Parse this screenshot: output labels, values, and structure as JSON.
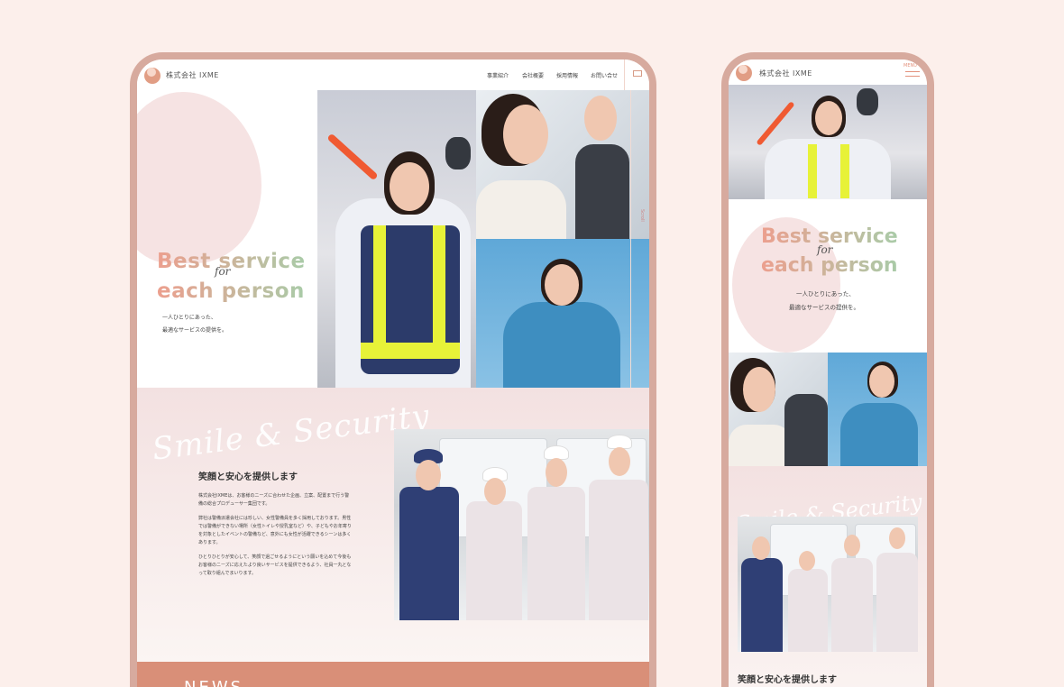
{
  "desktop": {
    "company": "株式会社 IXME",
    "nav": [
      "事業紹介",
      "会社概要",
      "採用情報",
      "お問い合せ"
    ],
    "hero": {
      "line1": "Best service",
      "for": "for",
      "line2": "each person",
      "sub1": "一人ひとりにあった、",
      "sub2": "最適なサービスの提供を。"
    },
    "vertical_text": "Scroll",
    "about": {
      "script": "Smile & Security",
      "title": "笑顔と安心を提供します",
      "p1": "株式会社IXMEは、お客様のニーズに合わせた企画、立案、配置まで行う警備の総合プロデューサー集団です。",
      "p2": "弊社は警備派遣会社には珍しい、女性警備員を多く採用しております。男性では警備ができない場所（女性トイレや授乳室など）や、子どもやお年寄りを対象としたイベントの警備など、意外にも女性が活躍できるシーンは多くあります。",
      "p3": "ひとりひとりが安心して、笑顔で過ごせるようにという願いを込めて今後もお客様のニーズに応えたより良いサービスを提供できるよう、社員一丸となって取り組んでまいります。"
    },
    "news_title": "NEWS"
  },
  "mobile": {
    "company": "株式会社 IXME",
    "menu_label": "MENU",
    "hero": {
      "line1": "Best service",
      "for": "for",
      "line2": "each person",
      "sub1": "一人ひとりにあった、",
      "sub2": "最適なサービスの提供を。"
    },
    "about": {
      "script": "Smile & Security",
      "title": "笑顔と安心を提供します"
    }
  },
  "colors": {
    "background": "#fcefeb",
    "frame": "#d7aa9e",
    "accent": "#d98f78",
    "gradient_start": "#ec9f8e",
    "gradient_end": "#a9cba8"
  }
}
